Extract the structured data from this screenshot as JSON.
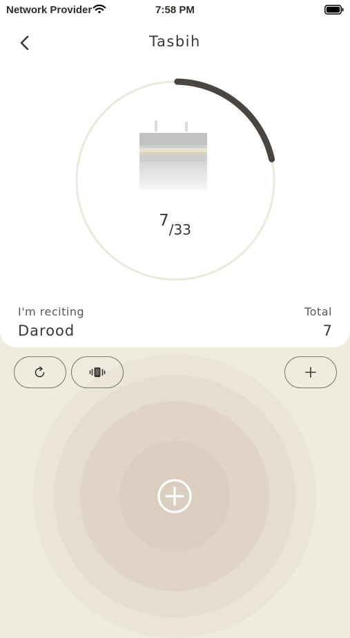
{
  "status_bar": {
    "carrier": "Network Provider",
    "time": "7:58 PM"
  },
  "header": {
    "title": "Tasbih",
    "back_icon": "chevron-left-icon"
  },
  "counter": {
    "current": "7",
    "slash": "/",
    "target": "33",
    "progress": 0.2121
  },
  "reciting": {
    "label": "I'm reciting",
    "value": "Darood"
  },
  "total": {
    "label": "Total",
    "value": "7"
  },
  "controls": {
    "reset_icon": "refresh-icon",
    "vibrate_icon": "vibrate-icon",
    "add_icon": "plus-icon",
    "tap_icon": "plus-circle-icon"
  },
  "colors": {
    "background": "#efebdf",
    "card": "#ffffff",
    "ring_track": "#ebe8dc",
    "ring_progress": "#4a4540",
    "tap_ripple": "#d9c9bc"
  }
}
